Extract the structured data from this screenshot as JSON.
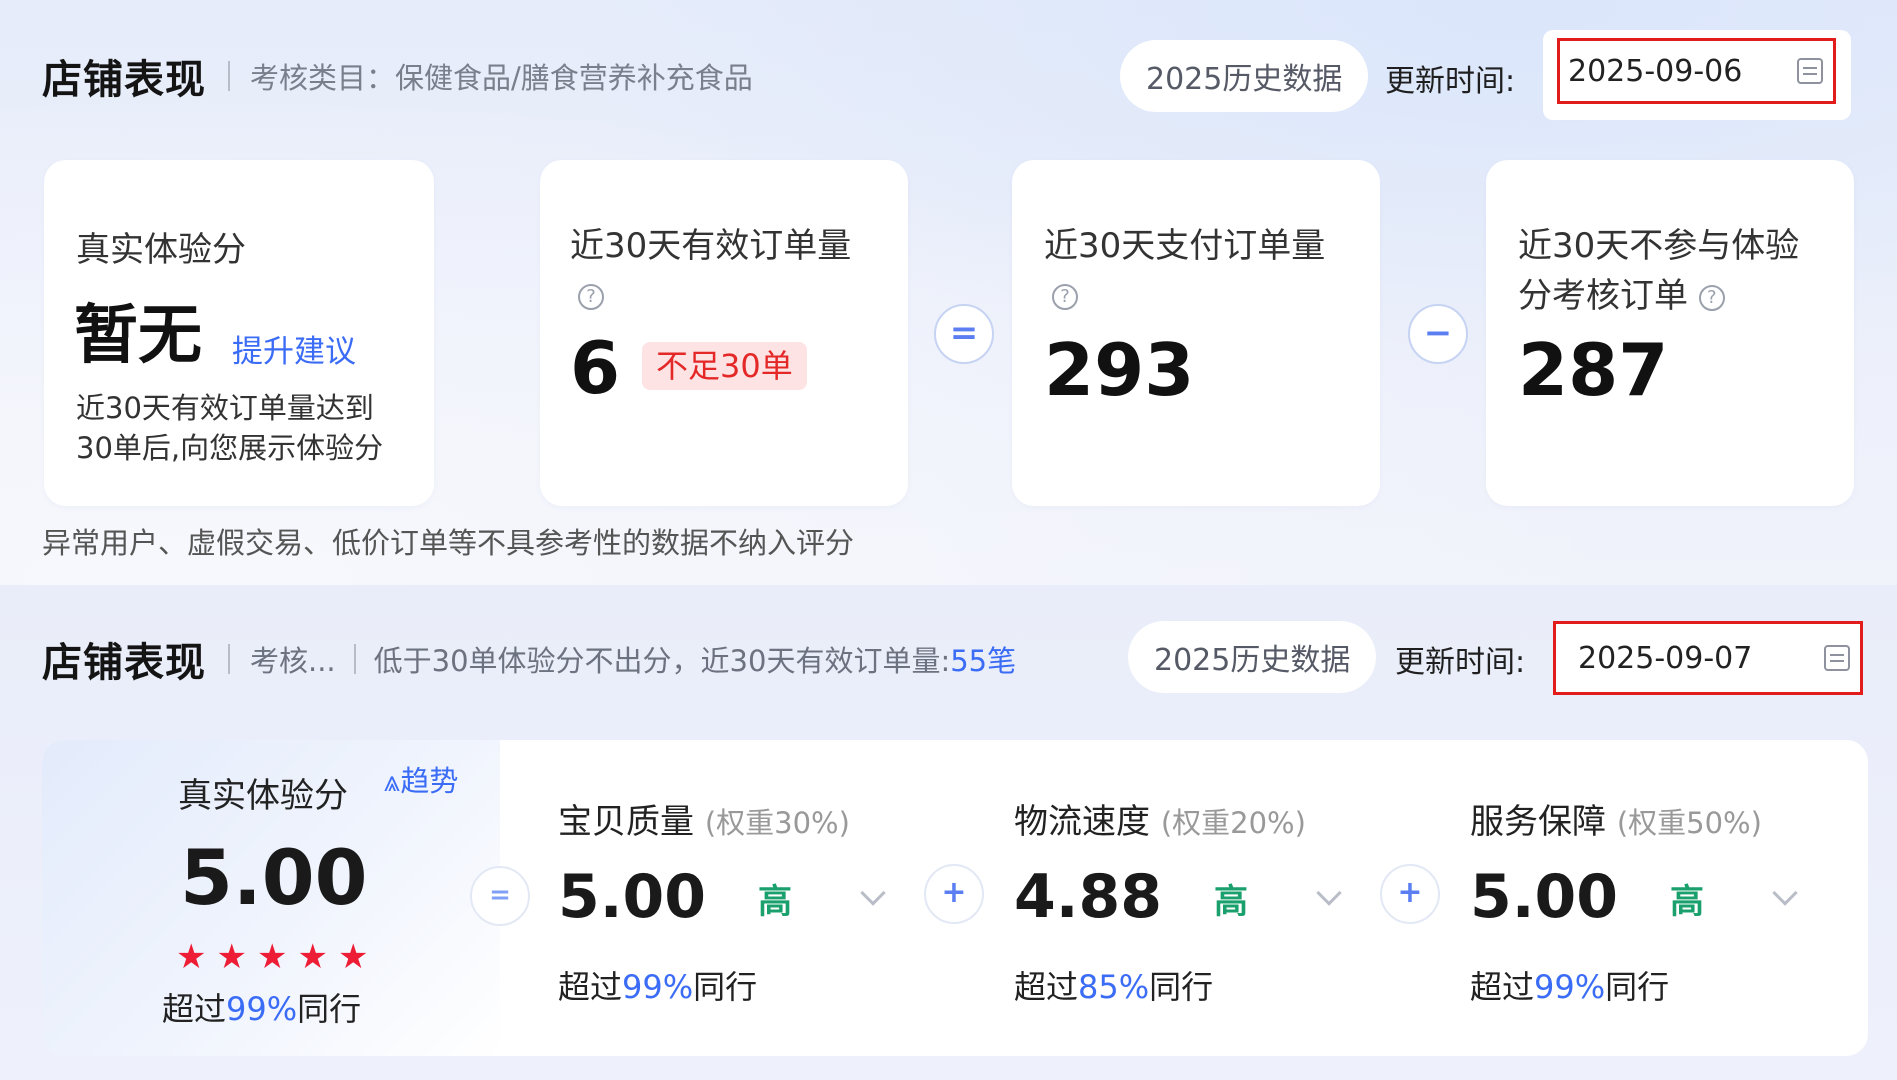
{
  "top": {
    "title": "店铺表现",
    "category": "考核类目：保健食品/膳食营养补充食品",
    "history_btn": "2025历史数据",
    "update_label": "更新时间:",
    "update_date": "2025-09-06",
    "cards": {
      "score": {
        "label": "真实体验分",
        "value": "暂无",
        "link": "提升建议",
        "desc_line1": "近30天有效订单量达到",
        "desc_line2": "30单后,向您展示体验分"
      },
      "valid": {
        "label": "近30天有效订单量",
        "value": "6",
        "tag": "不足30单"
      },
      "paid": {
        "label": "近30天支付订单量",
        "value": "293"
      },
      "excluded": {
        "label_line1": "近30天不参与体验",
        "label_line2": "分考核订单",
        "value": "287"
      }
    },
    "op_eq": "=",
    "op_minus": "−",
    "note": "异常用户、虚假交易、低价订单等不具参考性的数据不纳入评分"
  },
  "bottom": {
    "title": "店铺表现",
    "category_short": "考核...",
    "info_prefix": "低于30单体验分不出分，近30天有效订单量:",
    "info_value": "55笔",
    "history_btn": "2025历史数据",
    "update_label": "更新时间:",
    "update_date": "2025-09-07",
    "score": {
      "label": "真实体验分",
      "trend": "趋势",
      "value": "5.00",
      "exceed_prefix": "超过",
      "exceed_pct": "99%",
      "exceed_suffix": "同行",
      "stars": 5
    },
    "op_eq": "=",
    "op_plus": "+",
    "metrics": [
      {
        "title": "宝贝质量",
        "weight": "(权重30%)",
        "value": "5.00",
        "level": "高",
        "exceed_prefix": "超过",
        "exceed_pct": "99%",
        "exceed_suffix": "同行"
      },
      {
        "title": "物流速度",
        "weight": "(权重20%)",
        "value": "4.88",
        "level": "高",
        "exceed_prefix": "超过",
        "exceed_pct": "85%",
        "exceed_suffix": "同行"
      },
      {
        "title": "服务保障",
        "weight": "(权重50%)",
        "value": "5.00",
        "level": "高",
        "exceed_prefix": "超过",
        "exceed_pct": "99%",
        "exceed_suffix": "同行"
      }
    ]
  },
  "colors": {
    "accent": "#3b6cf6",
    "alert": "#e21b1b",
    "level": "#1aa06d",
    "star": "#ee1d36"
  },
  "icons": [
    "question-icon",
    "calendar-icon",
    "trend-icon",
    "star-icon",
    "chevron-down-icon"
  ]
}
